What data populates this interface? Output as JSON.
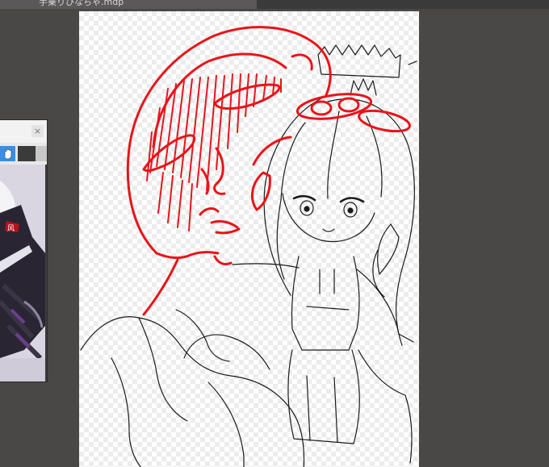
{
  "document": {
    "tab_title": "手乗りひなちゃ.mdp"
  },
  "navigator": {
    "close_label": "×",
    "preview_badge_text": "风"
  },
  "icons": {
    "close": "close-icon",
    "hand_tool": "hand-icon"
  },
  "colors": {
    "workspace_bg": "#4a4747",
    "accent_selected_tool": "#3b8fe0",
    "redline_stroke": "#e8141a",
    "lineart_stroke": "#1a1a1a"
  }
}
